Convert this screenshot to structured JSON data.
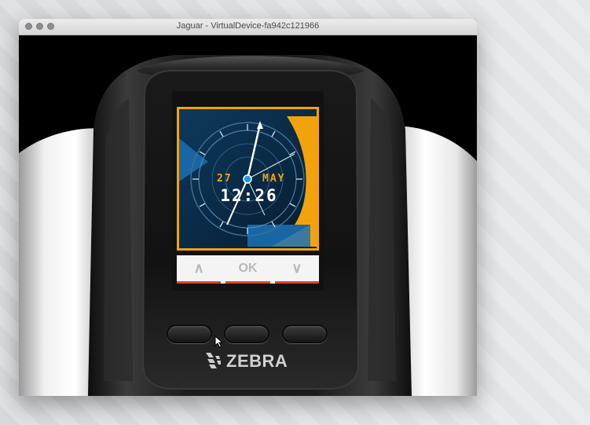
{
  "window": {
    "title": "Jaguar - VirtualDevice-fa942c121966"
  },
  "screen": {
    "date_day": "27",
    "date_month": "MAY",
    "time": "12:26",
    "softkeys": [
      {
        "name": "up",
        "label": "∧"
      },
      {
        "name": "ok",
        "label": "OK"
      },
      {
        "name": "down",
        "label": "∨"
      }
    ]
  },
  "device": {
    "brand": "ZEBRA"
  },
  "colors": {
    "accent_orange": "#f2a20c",
    "watch_blue": "#1b73b8",
    "softkey_underline": "#d9442b"
  }
}
